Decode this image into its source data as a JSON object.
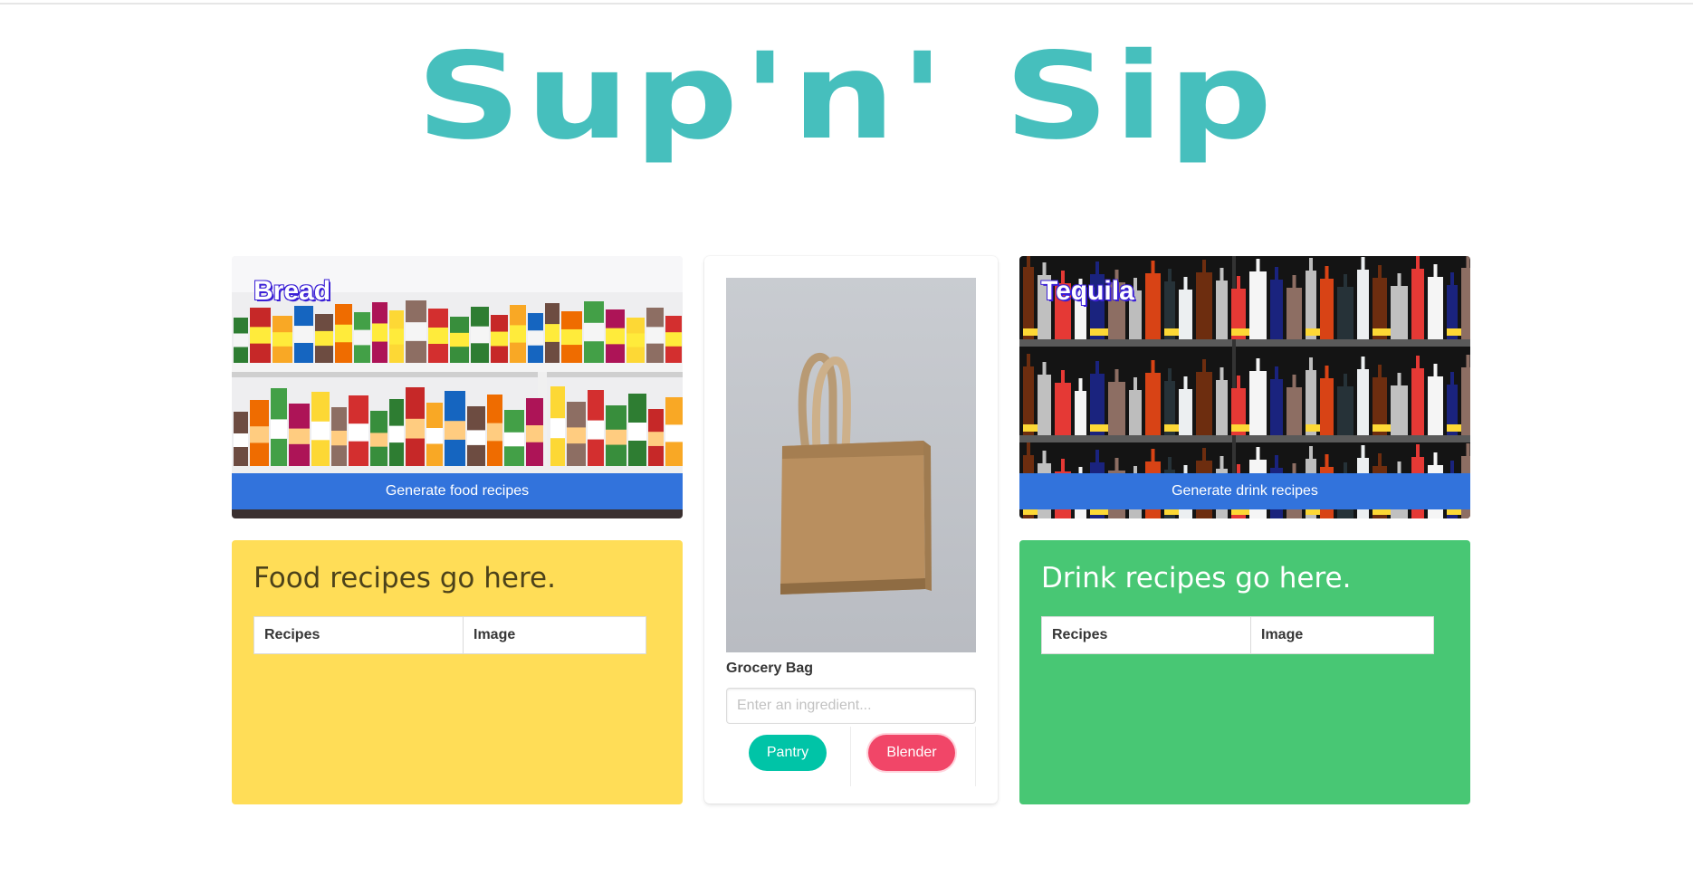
{
  "site": {
    "title": "Sup'n' Sip",
    "accent_color": "#46bfbd"
  },
  "food": {
    "ingredient": "Bread",
    "generate_label": "Generate food recipes",
    "heading": "Food recipes go here.",
    "table_headers": [
      "Recipes",
      "Image"
    ],
    "panel_color": "#ffdd57"
  },
  "drink": {
    "ingredient": "Tequila",
    "generate_label": "Generate drink recipes",
    "heading": "Drink recipes go here.",
    "table_headers": [
      "Recipes",
      "Image"
    ],
    "panel_color": "#48c774"
  },
  "grocery": {
    "label": "Grocery Bag",
    "input_placeholder": "Enter an ingredient...",
    "pantry_label": "Pantry",
    "blender_label": "Blender"
  },
  "colors": {
    "button_blue": "#3273dc",
    "pantry": "#00c4a7",
    "blender": "#f14668"
  }
}
